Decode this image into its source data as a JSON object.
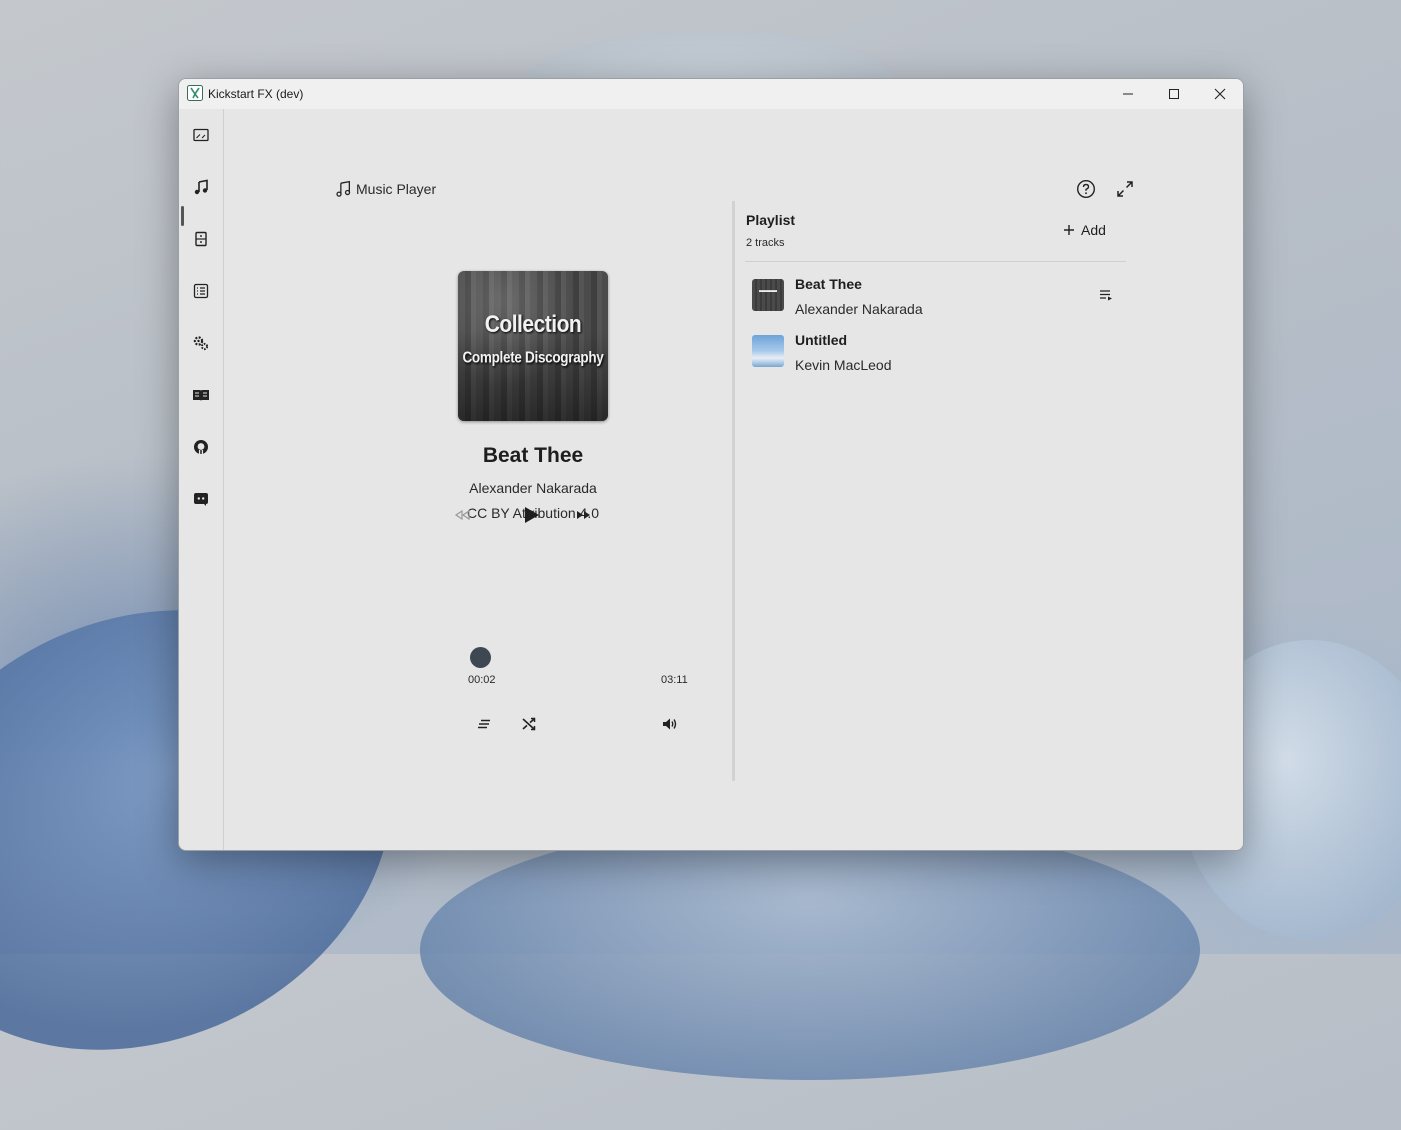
{
  "window": {
    "title": "Kickstart FX (dev)"
  },
  "sidebar": {
    "items": [
      {
        "icon": "image-frame-icon",
        "active": false
      },
      {
        "icon": "music-note-icon",
        "active": true
      },
      {
        "icon": "cabinet-icon",
        "active": false
      },
      {
        "icon": "list-icon",
        "active": false
      },
      {
        "icon": "gears-icon",
        "active": false
      },
      {
        "icon": "book-icon",
        "active": false
      },
      {
        "icon": "github-icon",
        "active": false
      },
      {
        "icon": "discord-icon",
        "active": false
      }
    ]
  },
  "header": {
    "title": "Music Player"
  },
  "player": {
    "album_art": {
      "line1": "Collection",
      "line2": "Complete Discography"
    },
    "track_title": "Beat Thee",
    "artist": "Alexander Nakarada",
    "license": "CC BY Attribution 4.0",
    "time_current": "00:02",
    "time_total": "03:11",
    "progress": 0.01
  },
  "playlist": {
    "title": "Playlist",
    "count": "2 tracks",
    "add_label": "Add",
    "tracks": [
      {
        "title": "Beat Thee",
        "artist": "Alexander Nakarada"
      },
      {
        "title": "Untitled",
        "artist": "Kevin MacLeod"
      }
    ]
  },
  "colors": {
    "accent": "#3e4852",
    "background": "#e6e6e6"
  }
}
